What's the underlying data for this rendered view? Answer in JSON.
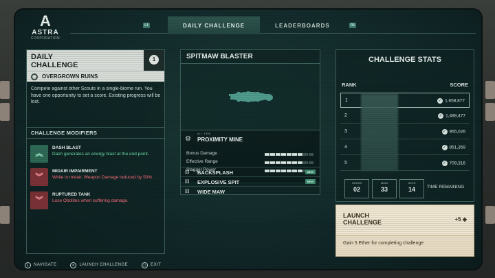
{
  "header": {
    "logo_mark": "A",
    "logo_name": "ASTRA",
    "logo_sub": "CORPORATION",
    "tabs": [
      {
        "label": "DAILY CHALLENGE",
        "active": true,
        "hint": "L1"
      },
      {
        "label": "LEADERBOARDS",
        "active": false,
        "hint": "R1"
      }
    ]
  },
  "daily": {
    "title": "DAILY CHALLENGE",
    "badge": "1",
    "biome": "OVERGROWN RUINS",
    "description": "Compete against other Scouts in a single-biome run. You have one opportunity to set a score. Existing progress will be lost.",
    "modifiers_title": "CHALLENGE MODIFIERS",
    "modifiers": [
      {
        "name": "DASH BLAST",
        "description": "Dash generates an energy blast at the end point.",
        "kind": "buff",
        "icon": "chevrons-up-icon"
      },
      {
        "name": "MIDAIR IMPAIRMENT",
        "description": "While in midair, Weapon Damage reduced by 50%.",
        "kind": "debuff",
        "icon": "chevrons-down-icon"
      },
      {
        "name": "RUPTURED TANK",
        "description": "Lose Obolites when suffering damage.",
        "kind": "debuff",
        "icon": "chevrons-down-icon"
      }
    ]
  },
  "weapon": {
    "name": "SPITMAW BLASTER",
    "alt_fire_tag": "ALT-FIRE",
    "alt_fire": "PROXIMITY MINE",
    "stats": [
      {
        "label": "Bonus Damage",
        "level": 7,
        "max": 9
      },
      {
        "label": "Effective Range",
        "level": 7,
        "max": 9
      },
      {
        "label": "Stagger Power",
        "level": 7,
        "max": 9
      }
    ],
    "traits": [
      {
        "roman": "II",
        "name": "BACKSPLASH",
        "badge": "NEW"
      },
      {
        "roman": "II",
        "name": "EXPLOSIVE SPIT",
        "badge": "NEW"
      },
      {
        "roman": "II",
        "name": "WIDE MAW",
        "badge": ""
      }
    ]
  },
  "stats": {
    "title": "CHALLENGE STATS",
    "rank_header": "RANK",
    "score_header": "SCORE",
    "rows": [
      {
        "rank": "1",
        "score": "1,658,877"
      },
      {
        "rank": "2",
        "score": "1,488,477"
      },
      {
        "rank": "3",
        "score": "955,026"
      },
      {
        "rank": "4",
        "score": "851,359"
      },
      {
        "rank": "5",
        "score": "709,316"
      }
    ],
    "time": {
      "hours_label": "HOURS",
      "hours": "02",
      "mins_label": "MINS",
      "mins": "33",
      "secs_label": "SECS",
      "secs": "14",
      "remaining": "TIME REMAINING"
    }
  },
  "launch": {
    "title": "LAUNCH CHALLENGE",
    "reward": "+5",
    "description": "Gain 5 Ether for completing challenge"
  },
  "footer": [
    {
      "glyph": "L",
      "label": "NAVIGATE"
    },
    {
      "glyph": "✕",
      "label": "LAUNCH CHALLENGE"
    },
    {
      "glyph": "○",
      "label": "EXIT"
    }
  ],
  "colors": {
    "accent": "#2f5650",
    "buff": "#6fe0a8",
    "debuff": "#ff6f7b",
    "launch_bg": "#e8dcc4"
  }
}
